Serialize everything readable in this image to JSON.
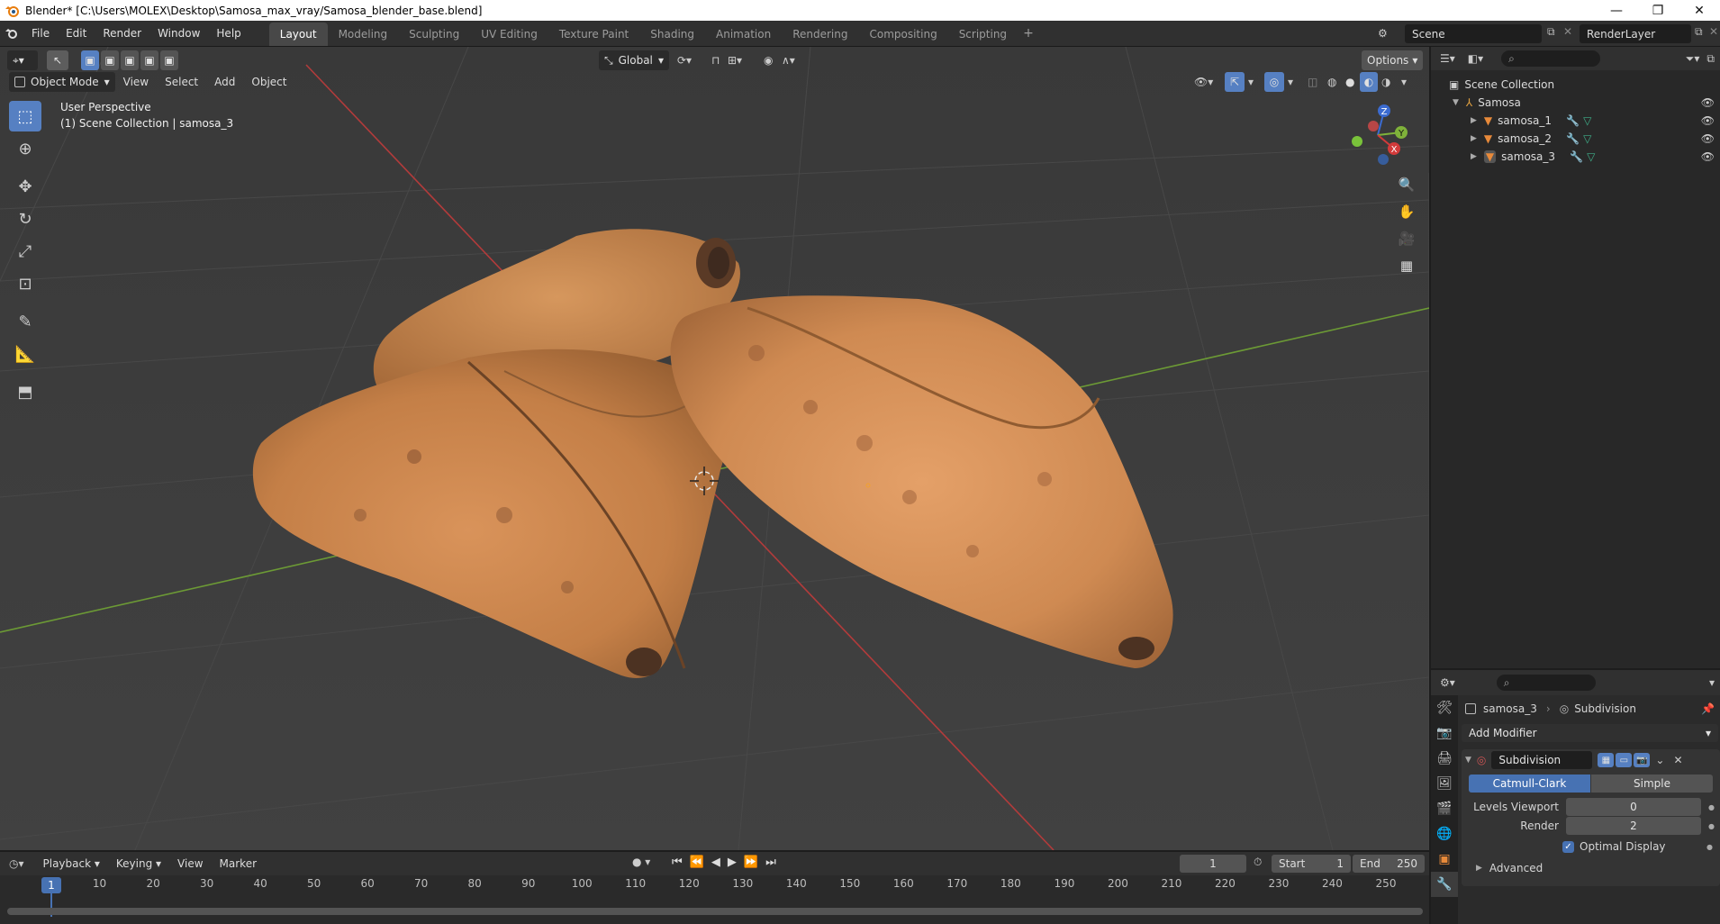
{
  "window": {
    "title": "Blender* [C:\\Users\\MOLEX\\Desktop\\Samosa_max_vray/Samosa_blender_base.blend]",
    "controls": [
      "—",
      "❐",
      "✕"
    ]
  },
  "menubar": {
    "menus": [
      "File",
      "Edit",
      "Render",
      "Window",
      "Help"
    ],
    "workspaces": [
      "Layout",
      "Modeling",
      "Sculpting",
      "UV Editing",
      "Texture Paint",
      "Shading",
      "Animation",
      "Rendering",
      "Compositing",
      "Scripting"
    ],
    "active_workspace": "Layout",
    "scene": "Scene",
    "view_layer": "RenderLayer"
  },
  "viewport": {
    "transform_orientation": "Global",
    "options_label": "Options",
    "mode": "Object Mode",
    "menus": [
      "View",
      "Select",
      "Add",
      "Object"
    ],
    "info_line1": "User Perspective",
    "info_line2": "(1) Scene Collection | samosa_3",
    "gizmo_axes": [
      "Z",
      "Y",
      "X"
    ]
  },
  "timeline": {
    "menus": [
      "Playback",
      "Keying",
      "View",
      "Marker"
    ],
    "current_frame": "1",
    "start_label": "Start",
    "start_value": "1",
    "end_label": "End",
    "end_value": "250",
    "ticks": [
      "1",
      "10",
      "20",
      "30",
      "40",
      "50",
      "60",
      "70",
      "80",
      "90",
      "100",
      "110",
      "120",
      "130",
      "140",
      "150",
      "160",
      "170",
      "180",
      "190",
      "200",
      "210",
      "220",
      "230",
      "240",
      "250"
    ]
  },
  "outliner": {
    "root": "Scene Collection",
    "collection": "Samosa",
    "objects": [
      "samosa_1",
      "samosa_2",
      "samosa_3"
    ]
  },
  "properties": {
    "object_name": "samosa_3",
    "modifier_context": "Subdivision",
    "add_modifier": "Add Modifier",
    "modifier_name": "Subdivision",
    "algorithm_options": [
      "Catmull-Clark",
      "Simple"
    ],
    "active_algorithm": "Catmull-Clark",
    "levels_viewport_label": "Levels Viewport",
    "levels_viewport_value": "0",
    "render_label": "Render",
    "render_value": "2",
    "optimal_display_label": "Optimal Display",
    "optimal_display_checked": true,
    "advanced_label": "Advanced"
  },
  "colors": {
    "accent_blue": "#5680c2",
    "x_axis": "#c63a3a",
    "y_axis": "#7fb23a",
    "frame_marker": "#4772b3"
  }
}
